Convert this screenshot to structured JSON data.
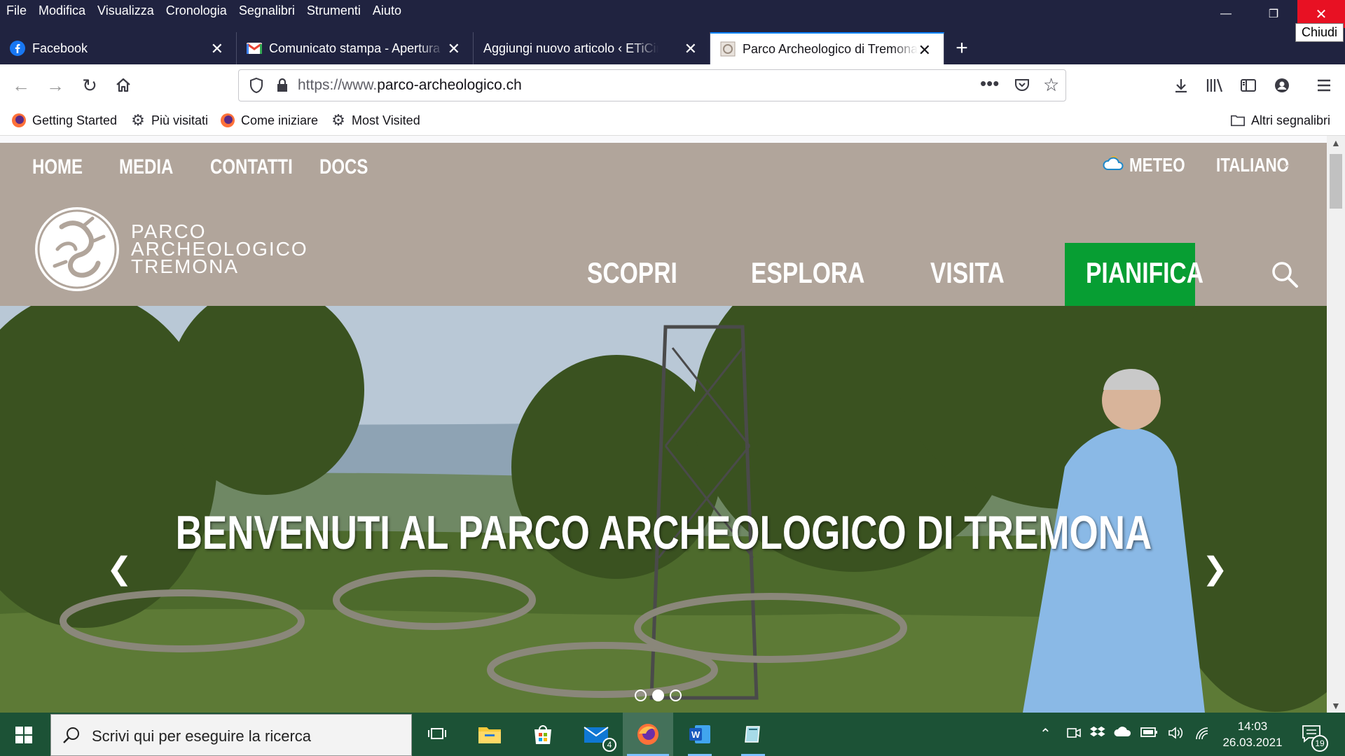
{
  "menu": [
    "File",
    "Modifica",
    "Visualizza",
    "Cronologia",
    "Segnalibri",
    "Strumenti",
    "Aiuto"
  ],
  "window": {
    "close_tooltip": "Chiudi"
  },
  "tabs": [
    {
      "label": "Facebook",
      "favicon": "facebook-icon"
    },
    {
      "label": "Comunicato stampa - Apertura",
      "favicon": "gmail-icon"
    },
    {
      "label": "Aggiungi nuovo articolo ‹ ETiCinform",
      "favicon": "none"
    },
    {
      "label": "Parco Archeologico di Tremona",
      "favicon": "page-icon",
      "active": true
    }
  ],
  "url": {
    "prefix": "https://www.",
    "domain": "parco-archeologico.ch"
  },
  "bookmarks": [
    {
      "label": "Getting Started",
      "icon": "firefox-icon"
    },
    {
      "label": "Più visitati",
      "icon": "gear-icon"
    },
    {
      "label": "Come iniziare",
      "icon": "firefox-icon"
    },
    {
      "label": "Most Visited",
      "icon": "gear-icon"
    }
  ],
  "other_bookmarks": "Altri segnalibri",
  "site": {
    "topnav": [
      "HOME",
      "MEDIA",
      "CONTATTI",
      "DOCS"
    ],
    "meteo": "METEO",
    "language": "ITALIANO",
    "logo_lines": [
      "PARCO",
      "ARCHEOLOGICO",
      "TREMONA"
    ],
    "mainnav": [
      "SCOPRI",
      "ESPLORA",
      "VISITA",
      "PIANIFICA"
    ],
    "hero_title": "BENVENUTI AL PARCO ARCHEOLOGICO DI TREMONA",
    "slider_dots": 3,
    "slider_active": 2
  },
  "taskbar": {
    "search_placeholder": "Scrivi qui per eseguire la ricerca",
    "mail_badge": "4",
    "time": "14:03",
    "date": "26.03.2021",
    "notifications": "19"
  },
  "colors": {
    "chrome_dark": "#202340",
    "header_bg": "#b1a59b",
    "pianifica_green": "#079e33",
    "taskbar": "#1c5236"
  }
}
